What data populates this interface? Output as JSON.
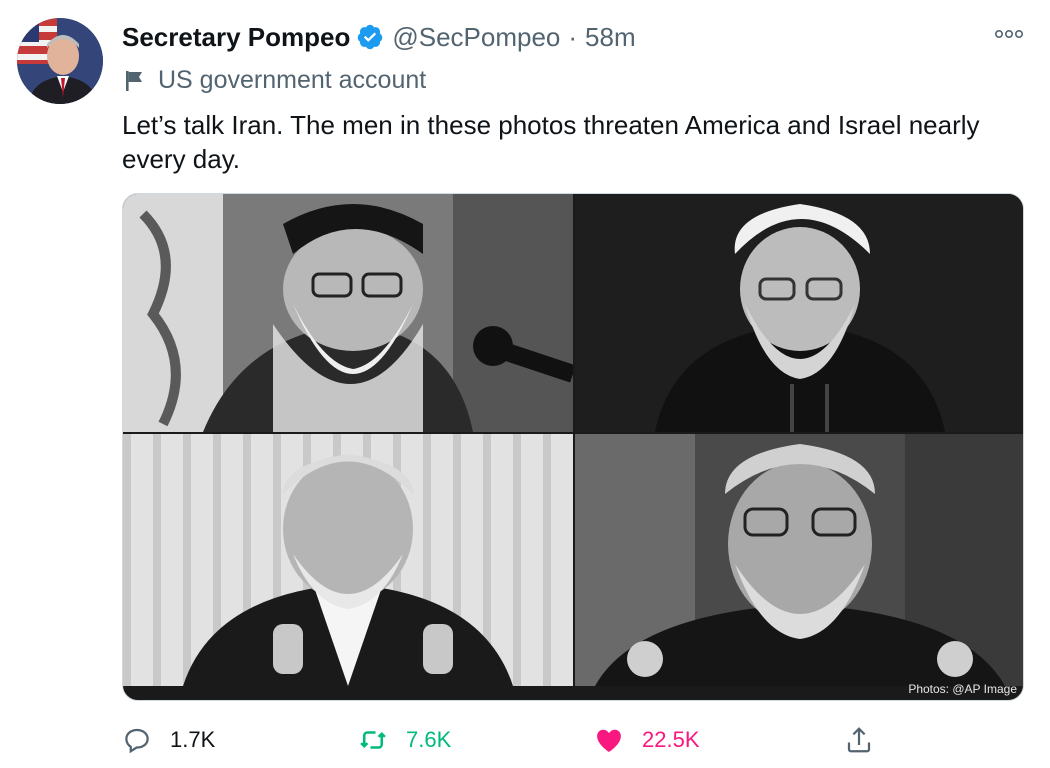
{
  "tweet": {
    "display_name": "Secretary Pompeo",
    "handle": "@SecPompeo",
    "separator": "·",
    "time": "58m",
    "label": "US government account",
    "text": "Let’s talk Iran. The men in these photos threaten America and Israel nearly every day.",
    "photo_credit": "Photos: @AP Image"
  },
  "actions": {
    "reply_count": "1.7K",
    "retweet_count": "7.6K",
    "like_count": "22.5K"
  },
  "colors": {
    "verified": "#1d9bf0",
    "retweet": "#00ba7c",
    "like": "#f91880",
    "secondary_text": "#536471"
  },
  "icons": [
    "verified-badge-icon",
    "more-icon",
    "flag-icon",
    "reply-icon",
    "retweet-icon",
    "like-icon",
    "share-icon"
  ]
}
